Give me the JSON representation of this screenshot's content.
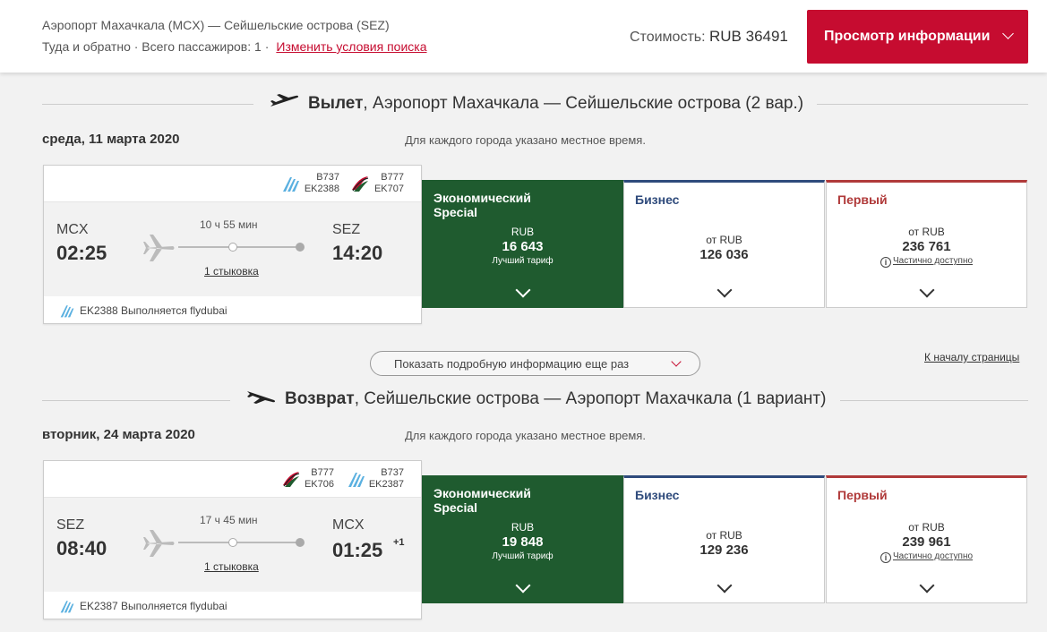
{
  "header": {
    "route": "Аэропорт Махачкала (MCX) — Сейшельские острова (SEZ)",
    "trip_info": "Туда и обратно · Всего пассажиров: 1 ·",
    "change_link": "Изменить условия поиска",
    "cost_label": "Стоимость:",
    "cost_value": "RUB 36491",
    "view_button": "Просмотр информации"
  },
  "outbound": {
    "title_bold": "Вылет",
    "title_rest": ", Аэропорт Махачкала — Сейшельские острова (2 вар.)",
    "date": "среда, 11 марта 2020",
    "local_time_note": "Для каждого города указано местное время.",
    "op1_aircraft": "B737",
    "op1_flight": "EK2388",
    "op2_aircraft": "B777",
    "op2_flight": "EK707",
    "from_code": "MCX",
    "from_time": "02:25",
    "to_code": "SEZ",
    "to_time": "14:20",
    "duration": "10 ч 55 мин",
    "stops": "1 стыковка",
    "operated": "EK2388 Выполняется flydubai",
    "fares": {
      "econ_name1": "Экономический",
      "econ_name2": "Special",
      "econ_cur": "RUB",
      "econ_price": "16 643",
      "econ_note": "Лучший тариф",
      "biz_name": "Бизнес",
      "biz_cur": "от RUB",
      "biz_price": "126 036",
      "first_name": "Первый",
      "first_cur": "от RUB",
      "first_price": "236 761",
      "first_note": "Частично доступно"
    }
  },
  "more_info": "Показать подробную информацию еще раз",
  "to_top": "К началу страницы",
  "return": {
    "title_bold": "Возврат",
    "title_rest": ", Сейшельские острова — Аэропорт Махачкала (1 вариант)",
    "date": "вторник, 24 марта 2020",
    "local_time_note": "Для каждого города указано местное время.",
    "op1_aircraft": "B777",
    "op1_flight": "EK706",
    "op2_aircraft": "B737",
    "op2_flight": "EK2387",
    "from_code": "SEZ",
    "from_time": "08:40",
    "to_code": "MCX",
    "to_time": "01:25",
    "plus_day": "+1",
    "duration": "17 ч 45 мин",
    "stops": "1 стыковка",
    "operated": "EK2387 Выполняется flydubai",
    "fares": {
      "econ_name1": "Экономический",
      "econ_name2": "Special",
      "econ_cur": "RUB",
      "econ_price": "19 848",
      "econ_note": "Лучший тариф",
      "biz_name": "Бизнес",
      "biz_cur": "от RUB",
      "biz_price": "129 236",
      "first_name": "Первый",
      "first_cur": "от RUB",
      "first_price": "239 961",
      "first_note": "Частично доступно"
    }
  },
  "colors": {
    "brand_red": "#c60c30",
    "economy_green": "#1f5b2f",
    "business_blue": "#2f4b7c",
    "first_red": "#b03a3a"
  }
}
